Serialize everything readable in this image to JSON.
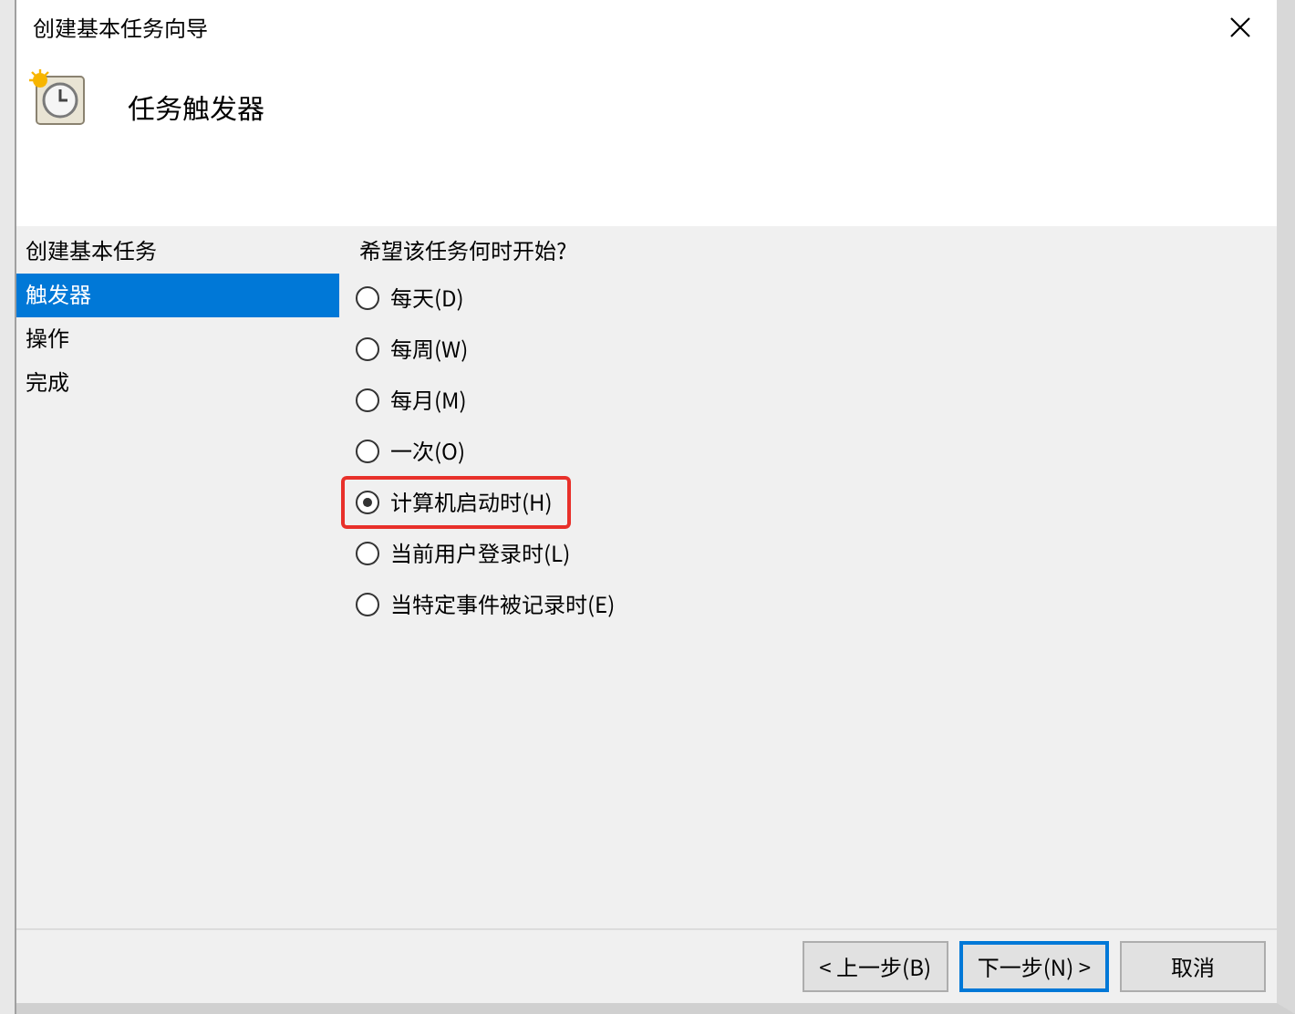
{
  "window": {
    "title": "创建基本任务向导"
  },
  "header": {
    "title": "任务触发器"
  },
  "steps": [
    {
      "label": "创建基本任务",
      "selected": false
    },
    {
      "label": "触发器",
      "selected": true
    },
    {
      "label": "操作",
      "selected": false
    },
    {
      "label": "完成",
      "selected": false
    }
  ],
  "question": "希望该任务何时开始?",
  "options": [
    {
      "label": "每天(D)",
      "selected": false,
      "highlighted": false
    },
    {
      "label": "每周(W)",
      "selected": false,
      "highlighted": false
    },
    {
      "label": "每月(M)",
      "selected": false,
      "highlighted": false
    },
    {
      "label": "一次(O)",
      "selected": false,
      "highlighted": false
    },
    {
      "label": "计算机启动时(H)",
      "selected": true,
      "highlighted": true
    },
    {
      "label": "当前用户登录时(L)",
      "selected": false,
      "highlighted": false
    },
    {
      "label": "当特定事件被记录时(E)",
      "selected": false,
      "highlighted": false
    }
  ],
  "buttons": [
    {
      "label": "< 上一步(B)",
      "default": false
    },
    {
      "label": "下一步(N) >",
      "default": true
    },
    {
      "label": "取消",
      "default": false
    }
  ]
}
